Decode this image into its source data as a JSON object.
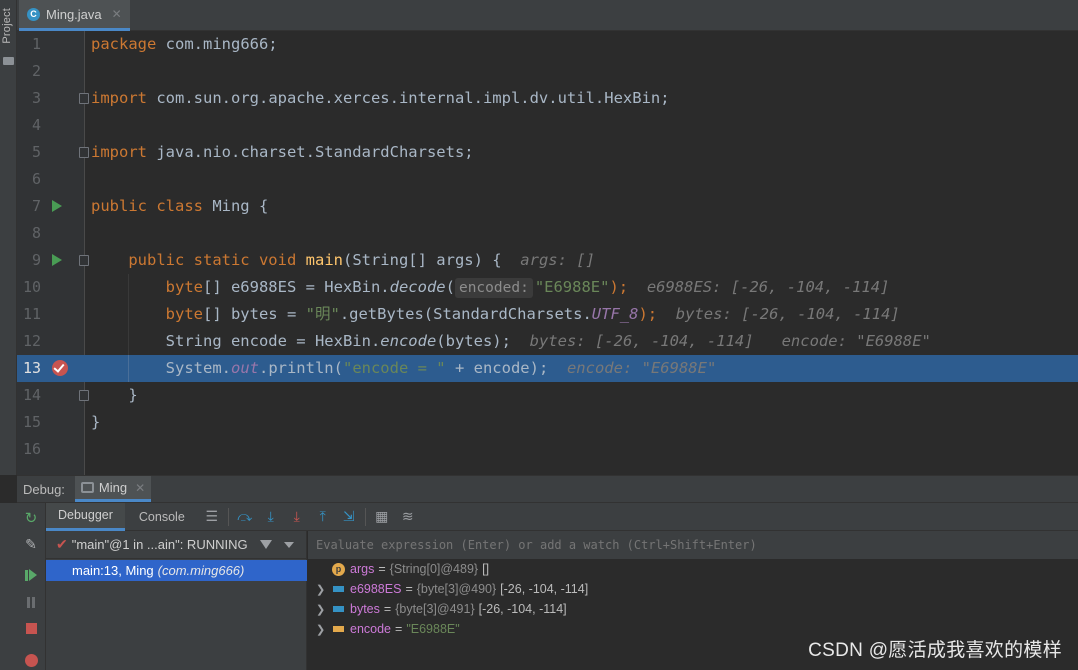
{
  "sidebar": {
    "project_label": "Project"
  },
  "tab": {
    "filename": "Ming.java",
    "icon": "C"
  },
  "editor": {
    "lines": [
      {
        "n": "1"
      },
      {
        "n": "2"
      },
      {
        "n": "3"
      },
      {
        "n": "4"
      },
      {
        "n": "5"
      },
      {
        "n": "6"
      },
      {
        "n": "7"
      },
      {
        "n": "8"
      },
      {
        "n": "9"
      },
      {
        "n": "10"
      },
      {
        "n": "11"
      },
      {
        "n": "12"
      },
      {
        "n": "13"
      },
      {
        "n": "14"
      },
      {
        "n": "15"
      },
      {
        "n": "16"
      }
    ],
    "tokens": {
      "l1_kw": "package",
      "l1_rest": " com.ming666;",
      "l3_kw": "import",
      "l3_rest": " com.sun.org.apache.xerces.internal.impl.dv.util.HexBin;",
      "l5_kw": "import",
      "l5_rest": " java.nio.charset.StandardCharsets;",
      "l7_kw": "public class",
      "l7_rest": " Ming {",
      "l9_kw": "public static void",
      "l9_fn": "main",
      "l9_rest": "(String[] args) {",
      "l9_hint": "args: []",
      "l10_kw": "byte",
      "l10_a": "[] e6988ES = HexBin.",
      "l10_m": "decode",
      "l10_b": "(",
      "l10_param": "encoded:",
      "l10_str": "\"E6988E\"",
      "l10_c": ");",
      "l10_hint": "e6988ES: [-26, -104, -114]",
      "l11_kw": "byte",
      "l11_a": "[] bytes = ",
      "l11_str": "\"明\"",
      "l11_b": ".getBytes(StandardCharsets.",
      "l11_f": "UTF_8",
      "l11_c": ");",
      "l11_hint": "bytes: [-26, -104, -114]",
      "l12_a": "String encode = HexBin.",
      "l12_m": "encode",
      "l12_b": "(bytes);",
      "l12_hint": "bytes: [-26, -104, -114]   encode: \"E6988E\"",
      "l13_a": "System.",
      "l13_f": "out",
      "l13_b": ".println(",
      "l13_str": "\"encode = \"",
      "l13_c": " + encode);",
      "l13_hint": "encode: \"E6988E\"",
      "l14": "}",
      "l15": "}"
    }
  },
  "debug": {
    "label": "Debug:",
    "session_tab": "Ming",
    "tabs": {
      "debugger": "Debugger",
      "console": "Console"
    },
    "thread": "\"main\"@1 in ...ain\": RUNNING",
    "frame": {
      "location": "main:13, Ming",
      "package": "(com.ming666)"
    },
    "watch_placeholder": "Evaluate expression (Enter) or add a watch (Ctrl+Shift+Enter)",
    "variables": [
      {
        "name": "args",
        "type": "{String[0]@489}",
        "value": "[]",
        "icon": "p-icon",
        "expandable": false
      },
      {
        "name": "e6988ES",
        "type": "{byte[3]@490}",
        "value": "[-26, -104, -114]",
        "icon": "array-icon",
        "expandable": true
      },
      {
        "name": "bytes",
        "type": "{byte[3]@491}",
        "value": "[-26, -104, -114]",
        "icon": "array-icon",
        "expandable": true
      },
      {
        "name": "encode",
        "type": "",
        "value": "\"E6988E\"",
        "icon": "string-icon",
        "expandable": true
      }
    ]
  },
  "watermark": "CSDN @愿活成我喜欢的模样",
  "colors": {
    "accent": "#4a88c7",
    "selection": "#2d5c8f",
    "frame_selection": "#2f65ca",
    "breakpoint": "#c75450"
  }
}
